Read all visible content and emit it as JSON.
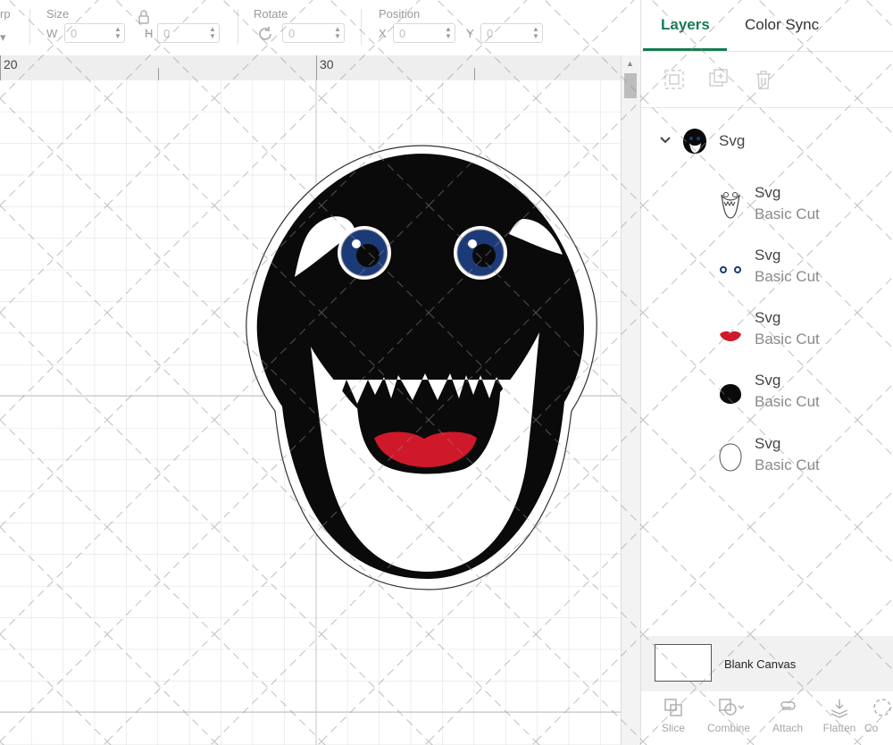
{
  "toolbar": {
    "cut_label": "rp",
    "size_label": "Size",
    "w_label": "W",
    "h_label": "H",
    "w_value": "0",
    "h_value": "0",
    "rotate_label": "Rotate",
    "rotate_value": "0",
    "position_label": "Position",
    "x_label": "X",
    "y_label": "Y",
    "x_value": "0",
    "y_value": "0"
  },
  "ruler": {
    "marks": [
      "20",
      "30"
    ]
  },
  "panel": {
    "tabs": [
      {
        "label": "Layers",
        "active": true
      },
      {
        "label": "Color Sync",
        "active": false
      }
    ],
    "group": {
      "name": "Svg"
    },
    "layers": [
      {
        "name": "Svg",
        "type": "Basic Cut",
        "thumb": "teeth-outline-icon"
      },
      {
        "name": "Svg",
        "type": "Basic Cut",
        "thumb": "eyes-icon"
      },
      {
        "name": "Svg",
        "type": "Basic Cut",
        "thumb": "tongue-icon"
      },
      {
        "name": "Svg",
        "type": "Basic Cut",
        "thumb": "black-head-icon"
      },
      {
        "name": "Svg",
        "type": "Basic Cut",
        "thumb": "outline-shape-icon"
      }
    ],
    "blank_canvas_label": "Blank Canvas",
    "bottom_actions": [
      "Slice",
      "Combine",
      "Attach",
      "Flatten",
      "Co"
    ]
  },
  "colors": {
    "accent": "#187b52",
    "eye_blue": "#1d3a78",
    "tongue_red": "#d0182b",
    "mascot_black": "#0a0a0a"
  }
}
